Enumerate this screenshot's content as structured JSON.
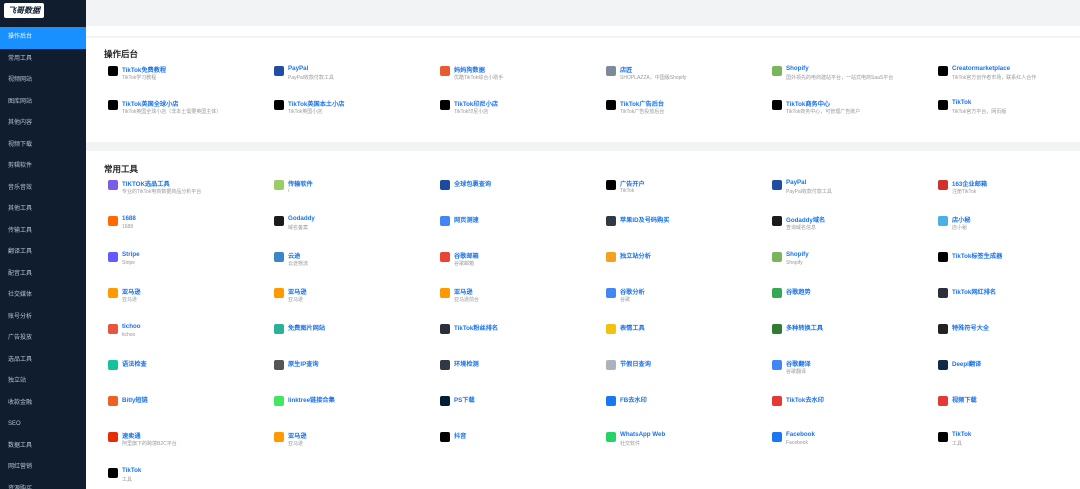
{
  "app": {
    "logo_text": "飞哥数据"
  },
  "sidebar": {
    "items": [
      "操作后台",
      "常用工具",
      "视频网站",
      "图库网站",
      "其他内容",
      "视频下载",
      "剪辑软件",
      "音乐音效",
      "其他工具",
      "传输工具",
      "翻译工具",
      "配音工具",
      "社交媒体",
      "账号分析",
      "广告投放",
      "选品工具",
      "独立站",
      "收款金融",
      "SEO",
      "数据工具",
      "网红营销",
      "资源购买"
    ],
    "active": "操作后台"
  },
  "sections": {
    "ops_title": "操作后台",
    "tools_title": "常用工具"
  },
  "ops_cards": [
    {
      "title": "TikTok免费教程",
      "desc": "TikTok学习教程",
      "icon": "tiktok-icon",
      "color": "#000000"
    },
    {
      "title": "PayPal",
      "desc": "PayPal收款付款工具",
      "icon": "paypal-icon",
      "color": "#1e4fa3"
    },
    {
      "title": "妈妈狗数据",
      "desc": "优酷TikTok综合小助手",
      "icon": "mamagou-icon",
      "color": "#e65c2e"
    },
    {
      "title": "店匠",
      "desc": "SHOPLAZZA，中国版Shopify",
      "icon": "shoplazza-icon",
      "color": "#7d8a99"
    },
    {
      "title": "Shopify",
      "desc": "国外领先的电商建站平台，一站式电商SaaS平台",
      "icon": "shopify-icon",
      "color": "#7ab55c"
    },
    {
      "title": "Creatormarketplace",
      "desc": "TikTok官方创作者市场，联系红人合作",
      "icon": "tiktok-icon",
      "color": "#000000"
    },
    {
      "title": "TikTok英国全球小店",
      "desc": "TikTok英国全球小店（非本土需要英国主体）",
      "icon": "tiktok-icon",
      "color": "#000000"
    },
    {
      "title": "TikTok英国本土小店",
      "desc": "TikTok英国小店",
      "icon": "tiktok-icon",
      "color": "#000000"
    },
    {
      "title": "TikTok印尼小店",
      "desc": "TikTok印尼小店",
      "icon": "tiktok-icon",
      "color": "#000000"
    },
    {
      "title": "TikTok广告后台",
      "desc": "TikTok广告投放后台",
      "icon": "tiktok-icon",
      "color": "#000000"
    },
    {
      "title": "TikTok商务中心",
      "desc": "TikTok商务中心，可管理广告账户",
      "icon": "tiktok-icon",
      "color": "#000000"
    },
    {
      "title": "TikTok",
      "desc": "TikTok官方平台，网页版",
      "icon": "tiktok-icon",
      "color": "#000000"
    }
  ],
  "tool_cards": [
    {
      "title": "TIKTOK选品工具",
      "desc": "专业的TikTok电商数据商品分析平台",
      "icon": "tiktok-select-icon",
      "color": "#7a5ce6"
    },
    {
      "title": "传输软件",
      "desc": "/",
      "icon": "transfer-icon",
      "color": "#9ccc65"
    },
    {
      "title": "全球包裹查询",
      "desc": "",
      "icon": "parcel-icon",
      "color": "#1b4b9c"
    },
    {
      "title": "广告开户",
      "desc": "TikTok",
      "icon": "tiktok-icon",
      "color": "#000000"
    },
    {
      "title": "PayPal",
      "desc": "PayPal收款付款工具",
      "icon": "paypal-icon",
      "color": "#1e4fa3"
    },
    {
      "title": "163企业邮箱",
      "desc": "注册TikTok",
      "icon": "mail163-icon",
      "color": "#d0312d"
    },
    {
      "title": "1688",
      "desc": "1688",
      "icon": "alibaba-icon",
      "color": "#ff6a00"
    },
    {
      "title": "Godaddy",
      "desc": "域名备案",
      "icon": "godaddy-icon",
      "color": "#1b1b1b"
    },
    {
      "title": "网页测速",
      "desc": "",
      "icon": "google-icon",
      "color": "#4285f4"
    },
    {
      "title": "苹果ID及号码购买",
      "desc": "",
      "icon": "appleid-icon",
      "color": "#2f3a44"
    },
    {
      "title": "Godaddy域名",
      "desc": "查询域名信息",
      "icon": "godaddy-icon",
      "color": "#1b1b1b"
    },
    {
      "title": "店小秘",
      "desc": "店小秘",
      "icon": "dianxiaomi-icon",
      "color": "#4ab0e6"
    },
    {
      "title": "Stripe",
      "desc": "Stripe",
      "icon": "stripe-icon",
      "color": "#635bff"
    },
    {
      "title": "云途",
      "desc": "云途物流",
      "icon": "yuntu-icon",
      "color": "#3a86c8"
    },
    {
      "title": "谷歌邮箱",
      "desc": "谷歌邮箱",
      "icon": "gmail-icon",
      "color": "#ea4335"
    },
    {
      "title": "独立站分析",
      "desc": "",
      "icon": "analysis-icon",
      "color": "#f4a020"
    },
    {
      "title": "Shopify",
      "desc": "Shopify",
      "icon": "shopify-icon",
      "color": "#7ab55c"
    },
    {
      "title": "TikTok标签生成器",
      "desc": "",
      "icon": "tiktok-icon",
      "color": "#000000"
    },
    {
      "title": "亚马逊",
      "desc": "亚马逊",
      "icon": "amazon-icon",
      "color": "#ff9900"
    },
    {
      "title": "亚马逊",
      "desc": "亚马逊",
      "icon": "amazon-icon",
      "color": "#ff9900"
    },
    {
      "title": "亚马逊",
      "desc": "亚马逊前台",
      "icon": "amazon-icon",
      "color": "#ff9900"
    },
    {
      "title": "谷歌分析",
      "desc": "谷歌",
      "icon": "google-icon",
      "color": "#4285f4"
    },
    {
      "title": "谷歌趋势",
      "desc": "",
      "icon": "trends-icon",
      "color": "#34a853"
    },
    {
      "title": "TikTok网红排名",
      "desc": "",
      "icon": "tiktok-rank-icon",
      "color": "#2a2f3a"
    },
    {
      "title": "tichoo",
      "desc": "tichoo",
      "icon": "tichoo-icon",
      "color": "#e8553d"
    },
    {
      "title": "免费图片网站",
      "desc": "",
      "icon": "image-site-icon",
      "color": "#2bb09a"
    },
    {
      "title": "TikTok粉丝排名",
      "desc": "",
      "icon": "tiktok-rank-icon",
      "color": "#2a2f3a"
    },
    {
      "title": "表情工具",
      "desc": "",
      "icon": "emoji-icon",
      "color": "#f4c20d"
    },
    {
      "title": "多种转换工具",
      "desc": "",
      "icon": "convert-icon",
      "color": "#2e7d32"
    },
    {
      "title": "特殊符号大全",
      "desc": "",
      "icon": "symbol-icon",
      "color": "#222222"
    },
    {
      "title": "语法检查",
      "desc": "",
      "icon": "grammar-icon",
      "color": "#15c39a"
    },
    {
      "title": "原生IP查询",
      "desc": "",
      "icon": "ip-icon",
      "color": "#555555"
    },
    {
      "title": "环境检测",
      "desc": "",
      "icon": "env-check-icon",
      "color": "#2f3a44"
    },
    {
      "title": "节假日查询",
      "desc": "",
      "icon": "holiday-icon",
      "color": "#aab4be"
    },
    {
      "title": "谷歌翻译",
      "desc": "谷歌翻译",
      "icon": "translate-icon",
      "color": "#4285f4"
    },
    {
      "title": "Deepl翻译",
      "desc": "",
      "icon": "deepl-icon",
      "color": "#0f2b46"
    },
    {
      "title": "Bitly短链",
      "desc": "",
      "icon": "bitly-icon",
      "color": "#ee6123"
    },
    {
      "title": "linktree链接合集",
      "desc": "",
      "icon": "linktree-icon",
      "color": "#43e660"
    },
    {
      "title": "PS下载",
      "desc": "",
      "icon": "ps-icon",
      "color": "#001e36"
    },
    {
      "title": "FB去水印",
      "desc": "",
      "icon": "fb-icon",
      "color": "#1877f2"
    },
    {
      "title": "TikTok去水印",
      "desc": "",
      "icon": "download-icon",
      "color": "#e53935"
    },
    {
      "title": "视频下载",
      "desc": "",
      "icon": "download-icon",
      "color": "#e53935"
    },
    {
      "title": "速卖通",
      "desc": "阿里旗下的跨境B2C平台",
      "icon": "aliexpress-icon",
      "color": "#e62e04"
    },
    {
      "title": "亚马逊",
      "desc": "亚马逊",
      "icon": "amazon-icon",
      "color": "#ff9900"
    },
    {
      "title": "抖音",
      "desc": "",
      "icon": "tiktok-icon",
      "color": "#000000"
    },
    {
      "title": "WhatsApp Web",
      "desc": "社交软件",
      "icon": "whatsapp-icon",
      "color": "#25d366"
    },
    {
      "title": "Facebook",
      "desc": "Facebook",
      "icon": "facebook-icon",
      "color": "#1877f2"
    },
    {
      "title": "TikTok",
      "desc": "工具",
      "icon": "tiktok-icon",
      "color": "#000000"
    },
    {
      "title": "TikTok",
      "desc": "工具",
      "icon": "tiktok-icon",
      "color": "#000000"
    }
  ]
}
